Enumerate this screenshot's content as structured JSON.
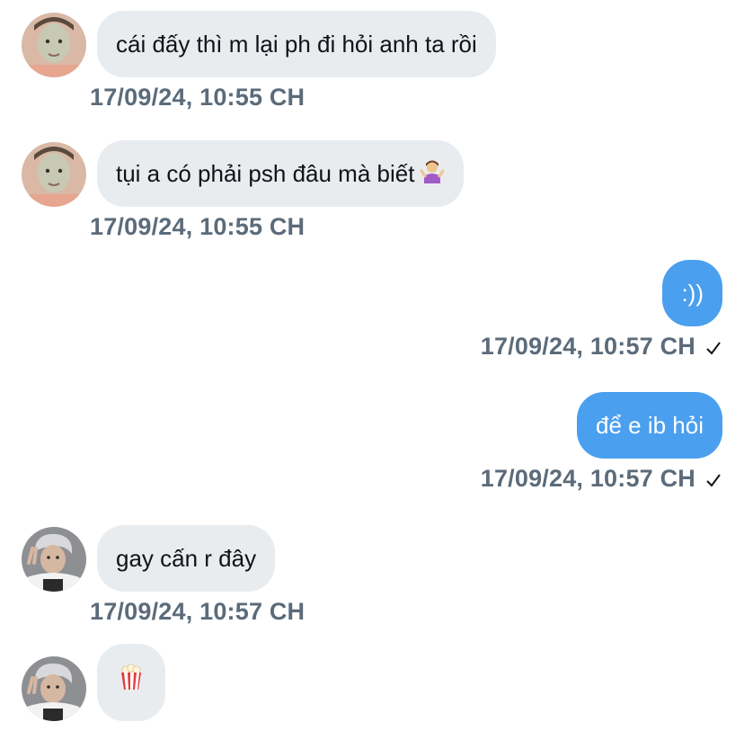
{
  "messages": [
    {
      "sender": "other",
      "avatar": "masked-person-avatar",
      "text": "cái đấy thì m lại ph đi hỏi anh ta rồi",
      "timestamp": "17/09/24, 10:55 CH"
    },
    {
      "sender": "other",
      "avatar": "masked-person-avatar",
      "text": "tụi a có phải psh đâu mà biết",
      "emoji": "woman-shrugging-emoji",
      "timestamp": "17/09/24, 10:55 CH"
    },
    {
      "sender": "me",
      "text": ":))",
      "timestamp": "17/09/24, 10:57 CH",
      "status": "sent"
    },
    {
      "sender": "me",
      "text": "để e ib hỏi",
      "timestamp": "17/09/24, 10:57 CH",
      "status": "sent"
    },
    {
      "sender": "other",
      "avatar": "peace-sign-person-avatar",
      "text": "gay cấn r đây",
      "timestamp": "17/09/24, 10:57 CH"
    },
    {
      "sender": "other",
      "avatar": "peace-sign-person-avatar",
      "emoji": "popcorn-emoji"
    }
  ],
  "colors": {
    "incoming_bubble": "#e9ecef",
    "outgoing_bubble": "#4a9fef",
    "timestamp_text": "#5b6b7a"
  }
}
